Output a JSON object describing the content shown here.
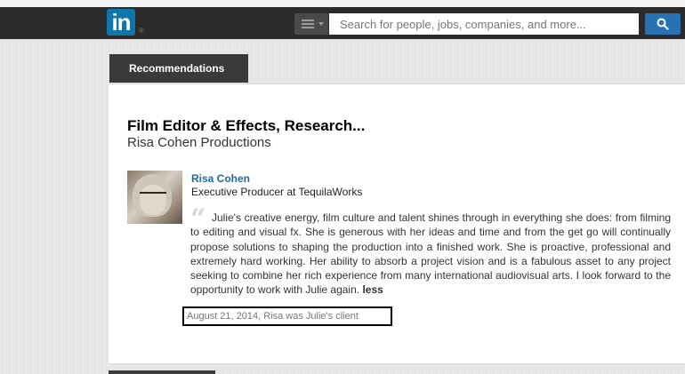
{
  "header": {
    "logo_text": "in",
    "search_placeholder": "Search for people, jobs, companies, and more...",
    "colors": {
      "bar": "#2b2b2b",
      "brand": "#0e76a8",
      "search_button": "#2672b3"
    }
  },
  "section": {
    "tab_label": "Recommendations"
  },
  "position": {
    "title": "Film Editor & Effects, Research...",
    "company": "Risa Cohen Productions"
  },
  "recommendation": {
    "name": "Risa Cohen",
    "role": "Executive Producer at TequilaWorks",
    "text": "Julie's creative energy, film culture and talent shines through in everything she does: from filming to editing and visual fx. She is generous with her ideas and time and from the get go will continually propose solutions to shaping the production into a finished work. She is proactive, professional and extremely hard working. Her ability to absorb a project vision and is a fabulous asset to any project seeking to combine her rich experience from many international audiovisual arts. I look forward to the opportunity to work with Julie again.",
    "less_label": "less",
    "meta": "August 21, 2014, Risa was Julie's client",
    "name_color": "#1d6aa5"
  }
}
